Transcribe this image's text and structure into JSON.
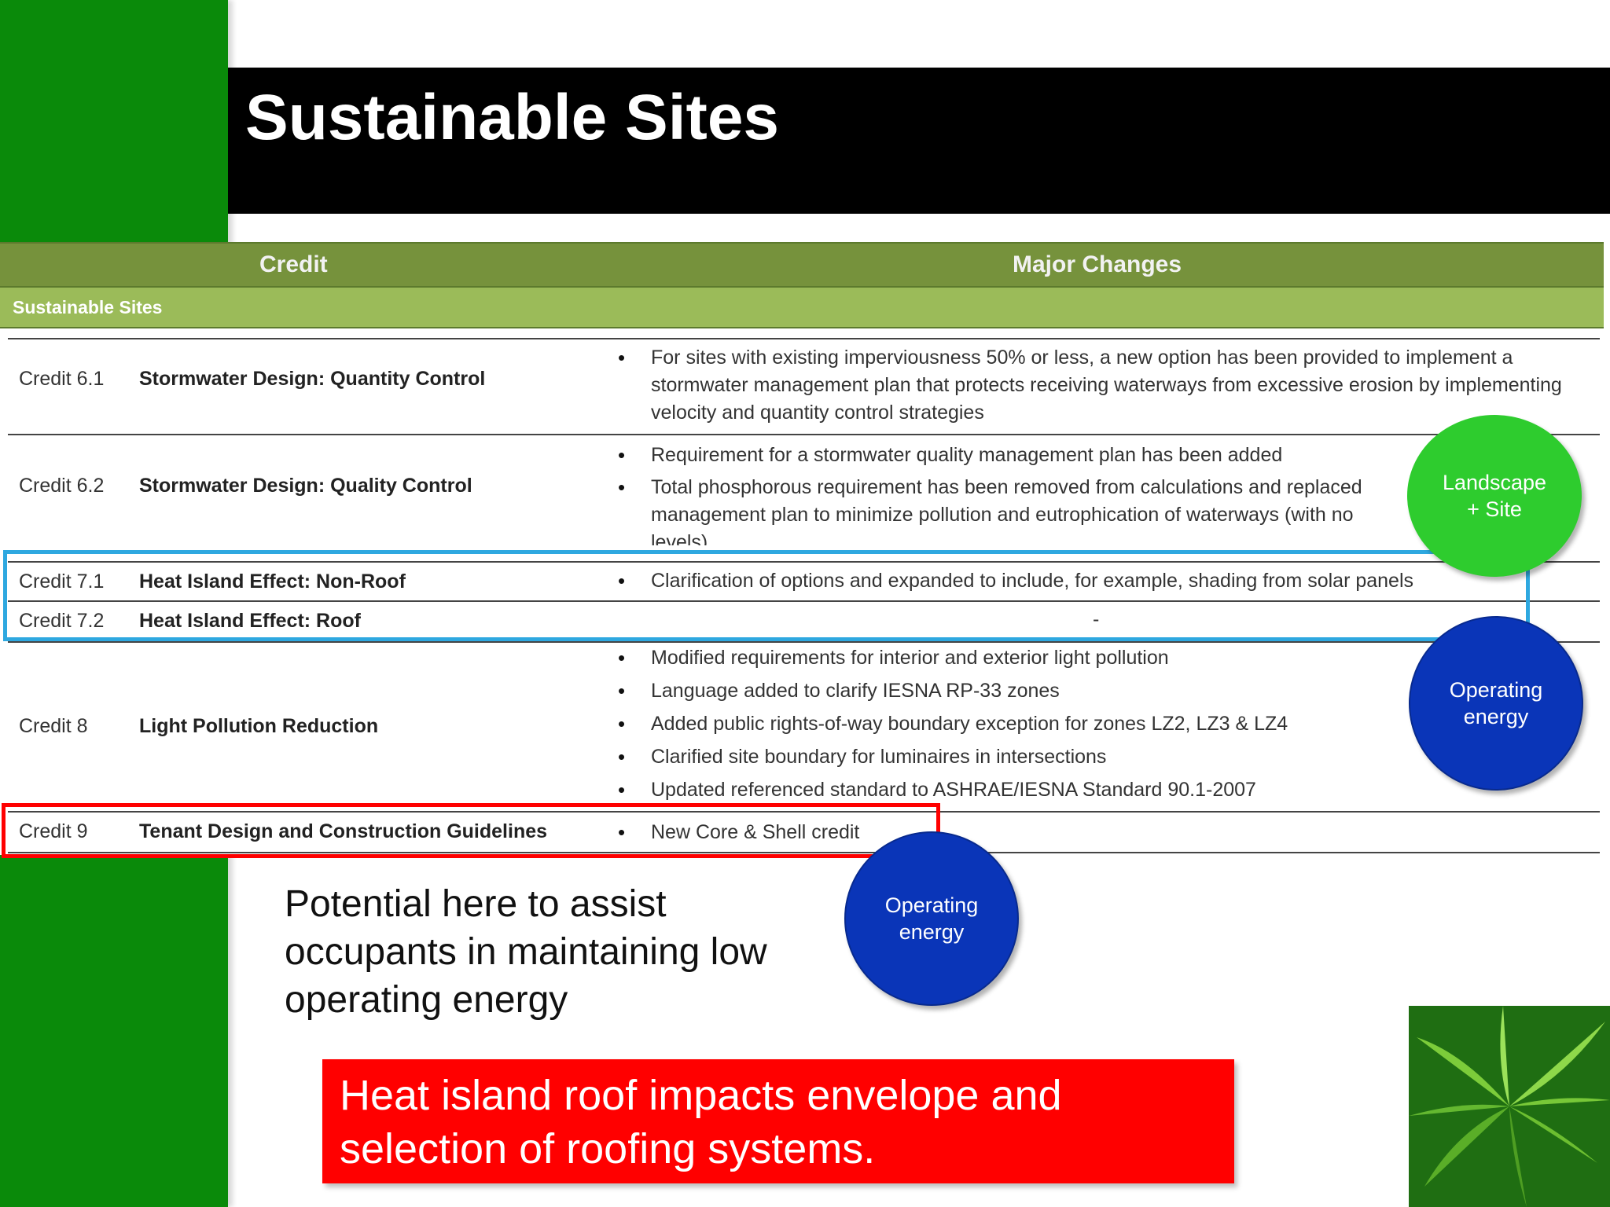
{
  "slide": {
    "title": "Sustainable Sites"
  },
  "table": {
    "headers": {
      "credit": "Credit",
      "changes": "Major Changes"
    },
    "section_label": "Sustainable Sites",
    "rows": [
      {
        "id": "Credit 6.1",
        "name": "Stormwater Design: Quantity Control",
        "bullets": [
          "For sites with existing imperviousness 50% or less, a new option has been provided to implement a stormwater management plan that protects receiving waterways from excessive erosion by implementing velocity and quantity control strategies"
        ]
      },
      {
        "id": "Credit 6.2",
        "name": "Stormwater Design: Quality Control",
        "bullets": [
          "Requirement for a stormwater quality management plan has been added",
          "Total phosphorous requirement has been removed from calculations and replaced management plan to minimize pollution and eutrophication of waterways (with no levels)"
        ]
      },
      {
        "id": "Credit 7.1",
        "name": "Heat Island Effect: Non-Roof",
        "bullets": [
          "Clarification of options and expanded to include, for example, shading from solar panels"
        ]
      },
      {
        "id": "Credit 7.2",
        "name": "Heat Island Effect: Roof",
        "dash": "-"
      },
      {
        "id": "Credit 8",
        "name": "Light Pollution Reduction",
        "bullets": [
          "Modified requirements for interior and exterior light pollution",
          "Language added to clarify IESNA RP-33 zones",
          "Added public rights-of-way boundary exception for zones LZ2, LZ3 & LZ4",
          "Clarified site boundary for luminaires in intersections",
          "Updated referenced standard to ASHRAE/IESNA Standard 90.1-2007"
        ]
      },
      {
        "id": "Credit 9",
        "name": "Tenant Design and Construction Guidelines",
        "bullets": [
          "New Core & Shell credit"
        ]
      }
    ]
  },
  "callouts": {
    "landscape": "Landscape + Site",
    "operating_1": "Operating energy",
    "operating_2": "Operating energy"
  },
  "note": "Potential here to assist occupants in maintaining low operating energy",
  "red_note": "Heat island roof impacts envelope and selection of roofing systems.",
  "colors": {
    "green_bar": "#0a8a0a",
    "table_header": "#76923c",
    "section_bar": "#9bbb59",
    "highlight_blue": "#2ea8e0",
    "highlight_red": "#ff0000",
    "circle_green": "#2ecc2e",
    "circle_blue": "#0a35b8"
  }
}
